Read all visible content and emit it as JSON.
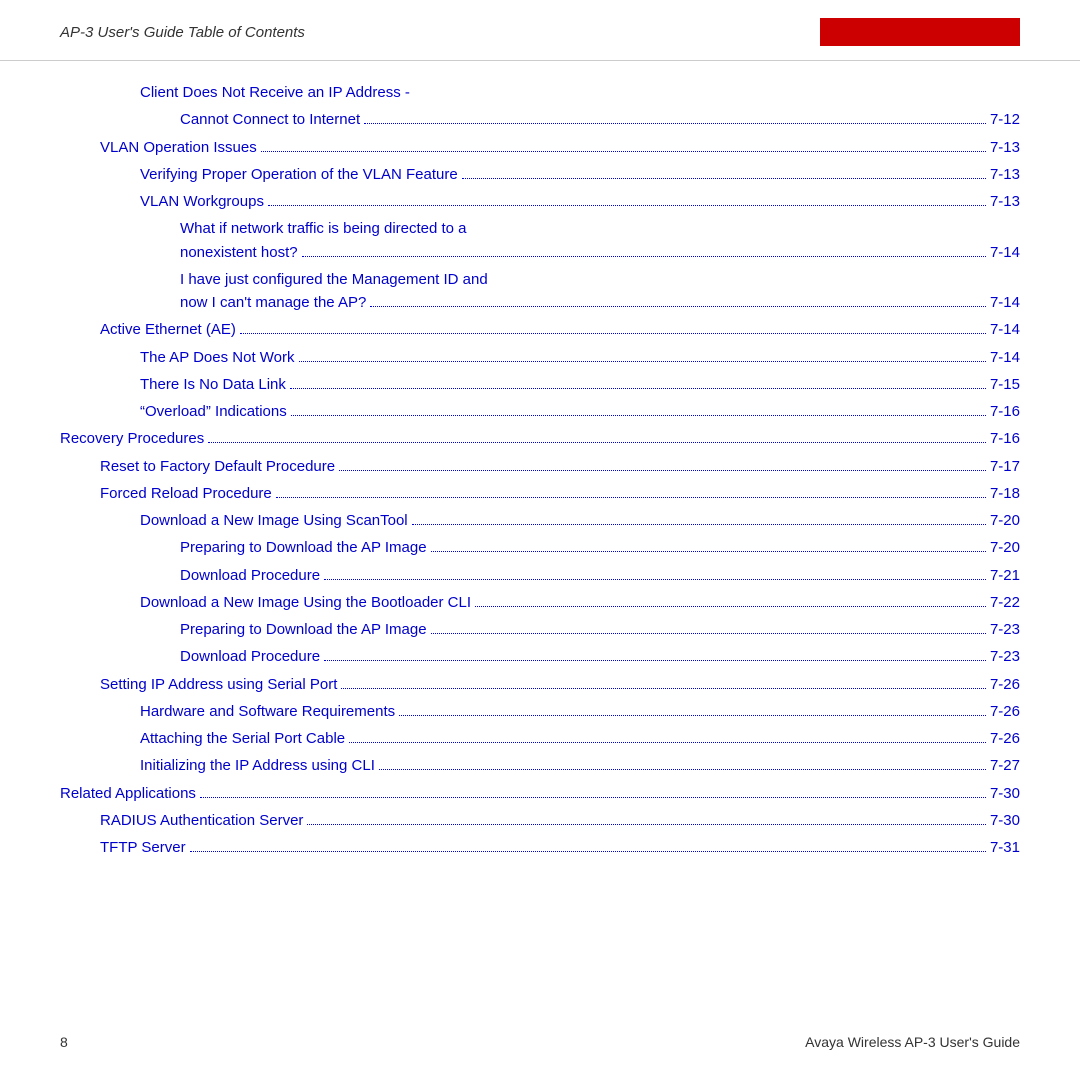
{
  "header": {
    "title": "AP-3 User's Guide Table of Contents"
  },
  "footer": {
    "page_num": "8",
    "doc_title": "Avaya Wireless AP-3 User's Guide"
  },
  "toc": [
    {
      "id": "entry1",
      "text": "Client Does Not Receive an IP Address -",
      "page": "",
      "indent": 2,
      "multiline": false,
      "nodots": true
    },
    {
      "id": "entry2",
      "text": "Cannot Connect to Internet",
      "page": "7-12",
      "indent": 3,
      "multiline": false
    },
    {
      "id": "entry3",
      "text": "VLAN Operation Issues",
      "page": "7-13",
      "indent": 1,
      "multiline": false
    },
    {
      "id": "entry4",
      "text": "Verifying Proper Operation of the VLAN Feature",
      "page": "7-13",
      "indent": 2,
      "multiline": false
    },
    {
      "id": "entry5",
      "text": "VLAN Workgroups",
      "page": "7-13",
      "indent": 2,
      "multiline": false
    },
    {
      "id": "entry6a",
      "text": "What if network traffic is being directed to a",
      "indent": 3,
      "multiline": true,
      "first_line": true
    },
    {
      "id": "entry6b",
      "text": "nonexistent host?",
      "page": "7-14",
      "indent": 3,
      "multiline": true,
      "last_line": true
    },
    {
      "id": "entry7a",
      "text": "I have just configured the Management ID and",
      "indent": 3,
      "multiline": true,
      "first_line": true
    },
    {
      "id": "entry7b",
      "text": "now I can't manage the AP?",
      "page": "7-14",
      "indent": 3,
      "multiline": true,
      "last_line": true
    },
    {
      "id": "entry8",
      "text": "Active Ethernet (AE)",
      "page": "7-14",
      "indent": 1,
      "multiline": false
    },
    {
      "id": "entry9",
      "text": "The AP Does Not Work",
      "page": "7-14",
      "indent": 2,
      "multiline": false
    },
    {
      "id": "entry10",
      "text": "There Is No Data Link",
      "page": "7-15",
      "indent": 2,
      "multiline": false
    },
    {
      "id": "entry11",
      "text": "“Overload” Indications",
      "page": "7-16",
      "indent": 2,
      "multiline": false
    },
    {
      "id": "entry12",
      "text": "Recovery Procedures",
      "page": "7-16",
      "indent": 0,
      "multiline": false
    },
    {
      "id": "entry13",
      "text": "Reset to Factory Default Procedure",
      "page": "7-17",
      "indent": 1,
      "multiline": false
    },
    {
      "id": "entry14",
      "text": "Forced Reload Procedure",
      "page": "7-18",
      "indent": 1,
      "multiline": false
    },
    {
      "id": "entry15",
      "text": "Download a New Image Using ScanTool",
      "page": "7-20",
      "indent": 2,
      "multiline": false
    },
    {
      "id": "entry16",
      "text": "Preparing to Download the AP Image",
      "page": "7-20",
      "indent": 3,
      "multiline": false
    },
    {
      "id": "entry17",
      "text": "Download Procedure",
      "page": "7-21",
      "indent": 3,
      "multiline": false
    },
    {
      "id": "entry18",
      "text": "Download a New Image Using the Bootloader CLI",
      "page": "7-22",
      "indent": 2,
      "multiline": false
    },
    {
      "id": "entry19",
      "text": "Preparing to Download the AP Image",
      "page": "7-23",
      "indent": 3,
      "multiline": false
    },
    {
      "id": "entry20",
      "text": "Download Procedure",
      "page": "7-23",
      "indent": 3,
      "multiline": false
    },
    {
      "id": "entry21",
      "text": "Setting IP Address using Serial Port",
      "page": "7-26",
      "indent": 1,
      "multiline": false
    },
    {
      "id": "entry22",
      "text": "Hardware and Software Requirements",
      "page": "7-26",
      "indent": 2,
      "multiline": false
    },
    {
      "id": "entry23",
      "text": "Attaching the Serial Port Cable",
      "page": "7-26",
      "indent": 2,
      "multiline": false
    },
    {
      "id": "entry24",
      "text": "Initializing the IP Address using CLI",
      "page": "7-27",
      "indent": 2,
      "multiline": false
    },
    {
      "id": "entry25",
      "text": "Related Applications",
      "page": "7-30",
      "indent": 0,
      "multiline": false
    },
    {
      "id": "entry26",
      "text": "RADIUS Authentication Server",
      "page": "7-30",
      "indent": 1,
      "multiline": false
    },
    {
      "id": "entry27",
      "text": "TFTP Server",
      "page": "7-31",
      "indent": 1,
      "multiline": false
    }
  ]
}
